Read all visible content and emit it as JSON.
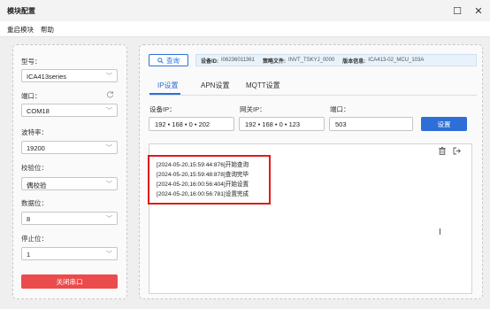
{
  "window": {
    "title": "模块配置",
    "minimize_glyph": "☐",
    "close_glyph": "✕"
  },
  "menu": {
    "items": [
      "重启模块",
      "帮助"
    ]
  },
  "serial": {
    "model_label": "型号：",
    "model_value": "ICA413series",
    "port_label": "端口：",
    "port_value": "COM18",
    "baud_label": "波特率：",
    "baud_value": "19200",
    "parity_label": "校验位：",
    "parity_value": "偶校验",
    "databits_label": "数据位：",
    "databits_value": "8",
    "stopbits_label": "停止位：",
    "stopbits_value": "1",
    "close_button": "关闭串口",
    "chevron": "﹀",
    "refresh_icon": "refresh-icon"
  },
  "query": {
    "button_label": "查询",
    "icon": "search-icon"
  },
  "device_info": {
    "id_label": "设备ID:",
    "id_value": "I06236011361",
    "policy_label": "策略文件:",
    "policy_value": "INVT_TSKYJ_0000",
    "version_label": "版本信息:",
    "version_value": "ICA413-02_MCU_103A"
  },
  "tabs": [
    "IP设置",
    "APN设置",
    "MQTT设置"
  ],
  "ip_settings": {
    "device_ip_label": "设备IP：",
    "device_ip": "192 •  168 •   0  •  202",
    "gateway_ip_label": "网关IP：",
    "gateway_ip": "192 •  168 •   0  •  123",
    "port_label": "端口：",
    "port_value": "503",
    "set_button": "设置"
  },
  "log": {
    "lines": [
      "[2024-05-20,15:59:44:876]开始查询",
      "[2024-05-20,15:59:48:878]查询完毕",
      "[2024-05-20,16:00:56:404]开始设置",
      "[2024-05-20,16:00:56:781]设置完成"
    ],
    "clear_icon": "trash-icon",
    "export_icon": "export-icon",
    "cursor": "I"
  },
  "colors": {
    "accent": "#2d6fd6",
    "danger": "#ec4b4b",
    "highlight": "#e11a1a",
    "info_bg": "#e7f2fa"
  }
}
